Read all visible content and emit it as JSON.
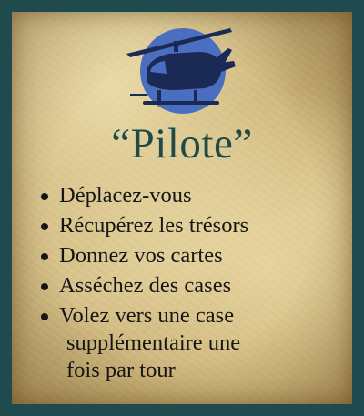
{
  "card": {
    "role_title": "“Pilote”",
    "actions": [
      "Déplacez-vous",
      "Récupérez les trésors",
      "Donnez vos cartes",
      "Asséchez des cases"
    ],
    "special_action": {
      "line1": "Volez vers une case",
      "line2": "supplémentaire une",
      "line3": "fois par tour"
    },
    "icon": "helicopter-icon"
  },
  "colors": {
    "border": "#1f4a4e",
    "title": "#1e4a47",
    "logo_circle": "#4a6fc0",
    "helicopter": "#1a2a55",
    "text": "#151515"
  }
}
